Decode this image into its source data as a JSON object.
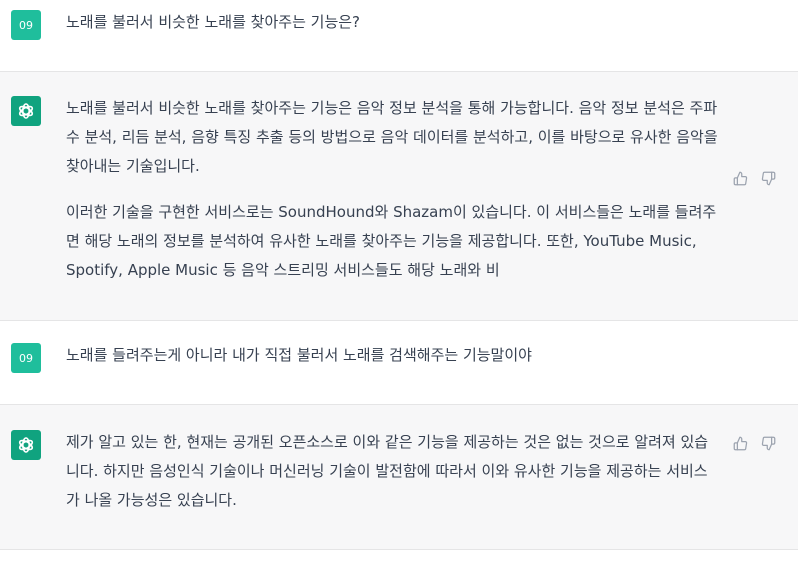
{
  "thread": {
    "messages": [
      {
        "role": "user",
        "avatar": "09",
        "paragraphs": [
          "노래를 불러서 비슷한 노래를 찾아주는 기능은?"
        ]
      },
      {
        "role": "assistant",
        "avatar_icon": "openai-logo-icon",
        "paragraphs": [
          "노래를 불러서 비슷한 노래를 찾아주는 기능은 음악 정보 분석을 통해 가능합니다. 음악 정보 분석은 주파수 분석, 리듬 분석, 음향 특징 추출 등의 방법으로 음악 데이터를 분석하고, 이를 바탕으로 유사한 음악을 찾아내는 기술입니다.",
          "이러한 기술을 구현한 서비스로는 SoundHound와 Shazam이 있습니다. 이 서비스들은 노래를 들려주면 해당 노래의 정보를 분석하여 유사한 노래를 찾아주는 기능을 제공합니다. 또한, YouTube Music, Spotify, Apple Music 등 음악 스트리밍 서비스들도 해당 노래와 비"
        ]
      },
      {
        "role": "user",
        "avatar": "09",
        "paragraphs": [
          "노래를 들려주는게 아니라 내가 직접 불러서 노래를 검색해주는 기능말이야"
        ]
      },
      {
        "role": "assistant",
        "avatar_icon": "openai-logo-icon",
        "paragraphs": [
          "제가 알고 있는 한, 현재는 공개된 오픈소스로 이와 같은 기능을 제공하는 것은 없는 것으로 알려져 있습니다. 하지만 음성인식 기술이나 머신러닝 기술이 발전함에 따라서 이와 유사한 기능을 제공하는 서비스가 나올 가능성은 있습니다."
        ]
      }
    ]
  },
  "colors": {
    "user_avatar": "#1fbe9c",
    "bot_avatar": "#10a37f",
    "assistant_bg": "#f7f7f8",
    "text": "#374151"
  }
}
